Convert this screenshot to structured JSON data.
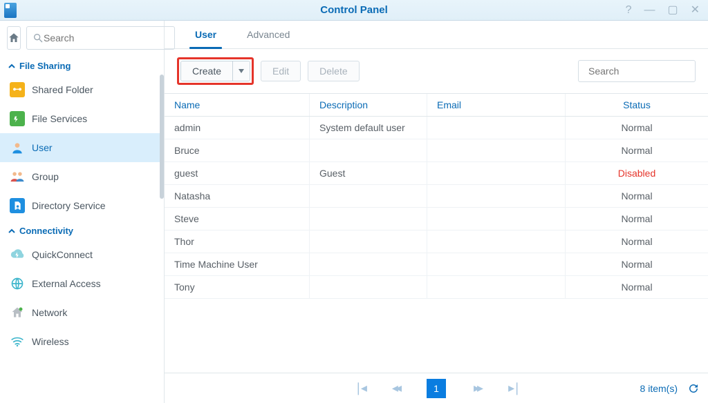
{
  "window": {
    "title": "Control Panel"
  },
  "sidebar": {
    "search_placeholder": "Search",
    "sections": [
      {
        "label": "File Sharing",
        "items": [
          {
            "key": "shared-folder",
            "label": "Shared Folder"
          },
          {
            "key": "file-services",
            "label": "File Services"
          },
          {
            "key": "user",
            "label": "User",
            "active": true
          },
          {
            "key": "group",
            "label": "Group"
          },
          {
            "key": "directory-service",
            "label": "Directory Service"
          }
        ]
      },
      {
        "label": "Connectivity",
        "items": [
          {
            "key": "quickconnect",
            "label": "QuickConnect"
          },
          {
            "key": "external-access",
            "label": "External Access"
          },
          {
            "key": "network",
            "label": "Network"
          },
          {
            "key": "wireless",
            "label": "Wireless"
          }
        ]
      }
    ]
  },
  "tabs": {
    "user": "User",
    "advanced": "Advanced",
    "active": "user"
  },
  "toolbar": {
    "create": "Create",
    "edit": "Edit",
    "delete": "Delete",
    "filter_placeholder": "Search"
  },
  "table": {
    "columns": {
      "name": "Name",
      "description": "Description",
      "email": "Email",
      "status": "Status"
    },
    "rows": [
      {
        "name": "admin",
        "description": "System default user",
        "email": "",
        "status": "Normal"
      },
      {
        "name": "Bruce",
        "description": "",
        "email": "",
        "status": "Normal"
      },
      {
        "name": "guest",
        "description": "Guest",
        "email": "",
        "status": "Disabled",
        "status_class": "disabled"
      },
      {
        "name": "Natasha",
        "description": "",
        "email": "",
        "status": "Normal"
      },
      {
        "name": "Steve",
        "description": "",
        "email": "",
        "status": "Normal"
      },
      {
        "name": "Thor",
        "description": "",
        "email": "",
        "status": "Normal"
      },
      {
        "name": "Time Machine User",
        "description": "",
        "email": "",
        "status": "Normal"
      },
      {
        "name": "Tony",
        "description": "",
        "email": "",
        "status": "Normal"
      }
    ]
  },
  "pager": {
    "current": "1",
    "count_label": "8 item(s)"
  }
}
